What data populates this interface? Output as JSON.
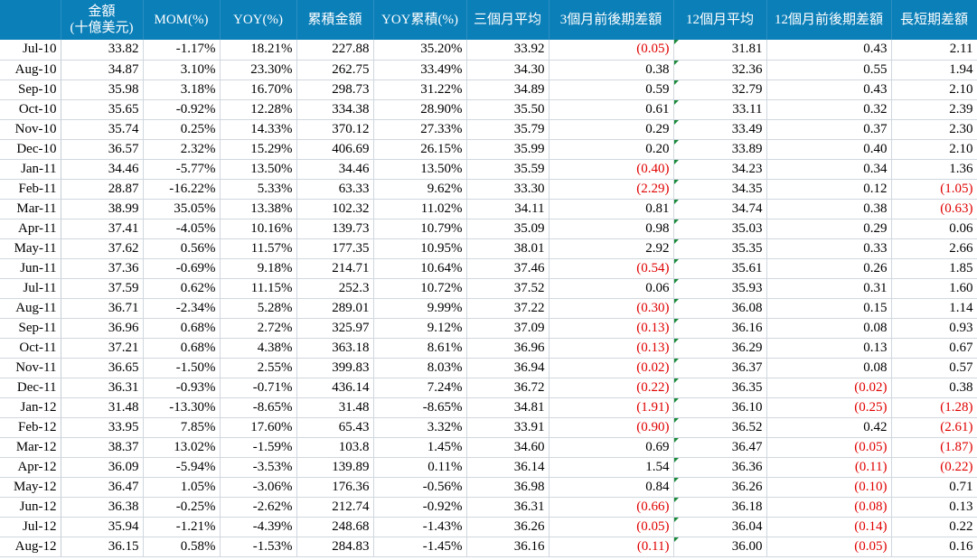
{
  "header": {
    "amount_line1": "金額",
    "amount_line2": "(十億美元)",
    "mom": "MOM(%)",
    "yoy": "YOY(%)",
    "cum_amount": "累積金額",
    "yoy_cum": "YOY累積(%)",
    "avg3": "三個月平均",
    "diff3": "3個月前後期差額",
    "avg12": "12個月平均",
    "diff12": "12個月前後期差額",
    "long_short": "長短期差額"
  },
  "rows": [
    {
      "month": "Jul-10",
      "amount": "33.82",
      "mom": "-1.17%",
      "yoy": "18.21%",
      "cum": "227.88",
      "yoycum": "35.20%",
      "avg3": "33.92",
      "diff3": "(0.05)",
      "avg12": "31.81",
      "diff12": "0.43",
      "ls": "2.11"
    },
    {
      "month": "Aug-10",
      "amount": "34.87",
      "mom": "3.10%",
      "yoy": "23.30%",
      "cum": "262.75",
      "yoycum": "33.49%",
      "avg3": "34.30",
      "diff3": "0.38",
      "avg12": "32.36",
      "diff12": "0.55",
      "ls": "1.94"
    },
    {
      "month": "Sep-10",
      "amount": "35.98",
      "mom": "3.18%",
      "yoy": "16.70%",
      "cum": "298.73",
      "yoycum": "31.22%",
      "avg3": "34.89",
      "diff3": "0.59",
      "avg12": "32.79",
      "diff12": "0.43",
      "ls": "2.10"
    },
    {
      "month": "Oct-10",
      "amount": "35.65",
      "mom": "-0.92%",
      "yoy": "12.28%",
      "cum": "334.38",
      "yoycum": "28.90%",
      "avg3": "35.50",
      "diff3": "0.61",
      "avg12": "33.11",
      "diff12": "0.32",
      "ls": "2.39"
    },
    {
      "month": "Nov-10",
      "amount": "35.74",
      "mom": "0.25%",
      "yoy": "14.33%",
      "cum": "370.12",
      "yoycum": "27.33%",
      "avg3": "35.79",
      "diff3": "0.29",
      "avg12": "33.49",
      "diff12": "0.37",
      "ls": "2.30"
    },
    {
      "month": "Dec-10",
      "amount": "36.57",
      "mom": "2.32%",
      "yoy": "15.29%",
      "cum": "406.69",
      "yoycum": "26.15%",
      "avg3": "35.99",
      "diff3": "0.20",
      "avg12": "33.89",
      "diff12": "0.40",
      "ls": "2.10"
    },
    {
      "month": "Jan-11",
      "amount": "34.46",
      "mom": "-5.77%",
      "yoy": "13.50%",
      "cum": "34.46",
      "yoycum": "13.50%",
      "avg3": "35.59",
      "diff3": "(0.40)",
      "avg12": "34.23",
      "diff12": "0.34",
      "ls": "1.36"
    },
    {
      "month": "Feb-11",
      "amount": "28.87",
      "mom": "-16.22%",
      "yoy": "5.33%",
      "cum": "63.33",
      "yoycum": "9.62%",
      "avg3": "33.30",
      "diff3": "(2.29)",
      "avg12": "34.35",
      "diff12": "0.12",
      "ls": "(1.05)"
    },
    {
      "month": "Mar-11",
      "amount": "38.99",
      "mom": "35.05%",
      "yoy": "13.38%",
      "cum": "102.32",
      "yoycum": "11.02%",
      "avg3": "34.11",
      "diff3": "0.81",
      "avg12": "34.74",
      "diff12": "0.38",
      "ls": "(0.63)"
    },
    {
      "month": "Apr-11",
      "amount": "37.41",
      "mom": "-4.05%",
      "yoy": "10.16%",
      "cum": "139.73",
      "yoycum": "10.79%",
      "avg3": "35.09",
      "diff3": "0.98",
      "avg12": "35.03",
      "diff12": "0.29",
      "ls": "0.06"
    },
    {
      "month": "May-11",
      "amount": "37.62",
      "mom": "0.56%",
      "yoy": "11.57%",
      "cum": "177.35",
      "yoycum": "10.95%",
      "avg3": "38.01",
      "diff3": "2.92",
      "avg12": "35.35",
      "diff12": "0.33",
      "ls": "2.66"
    },
    {
      "month": "Jun-11",
      "amount": "37.36",
      "mom": "-0.69%",
      "yoy": "9.18%",
      "cum": "214.71",
      "yoycum": "10.64%",
      "avg3": "37.46",
      "diff3": "(0.54)",
      "avg12": "35.61",
      "diff12": "0.26",
      "ls": "1.85"
    },
    {
      "month": "Jul-11",
      "amount": "37.59",
      "mom": "0.62%",
      "yoy": "11.15%",
      "cum": "252.3",
      "yoycum": "10.72%",
      "avg3": "37.52",
      "diff3": "0.06",
      "avg12": "35.93",
      "diff12": "0.31",
      "ls": "1.60"
    },
    {
      "month": "Aug-11",
      "amount": "36.71",
      "mom": "-2.34%",
      "yoy": "5.28%",
      "cum": "289.01",
      "yoycum": "9.99%",
      "avg3": "37.22",
      "diff3": "(0.30)",
      "avg12": "36.08",
      "diff12": "0.15",
      "ls": "1.14"
    },
    {
      "month": "Sep-11",
      "amount": "36.96",
      "mom": "0.68%",
      "yoy": "2.72%",
      "cum": "325.97",
      "yoycum": "9.12%",
      "avg3": "37.09",
      "diff3": "(0.13)",
      "avg12": "36.16",
      "diff12": "0.08",
      "ls": "0.93"
    },
    {
      "month": "Oct-11",
      "amount": "37.21",
      "mom": "0.68%",
      "yoy": "4.38%",
      "cum": "363.18",
      "yoycum": "8.61%",
      "avg3": "36.96",
      "diff3": "(0.13)",
      "avg12": "36.29",
      "diff12": "0.13",
      "ls": "0.67"
    },
    {
      "month": "Nov-11",
      "amount": "36.65",
      "mom": "-1.50%",
      "yoy": "2.55%",
      "cum": "399.83",
      "yoycum": "8.03%",
      "avg3": "36.94",
      "diff3": "(0.02)",
      "avg12": "36.37",
      "diff12": "0.08",
      "ls": "0.57"
    },
    {
      "month": "Dec-11",
      "amount": "36.31",
      "mom": "-0.93%",
      "yoy": "-0.71%",
      "cum": "436.14",
      "yoycum": "7.24%",
      "avg3": "36.72",
      "diff3": "(0.22)",
      "avg12": "36.35",
      "diff12": "(0.02)",
      "ls": "0.38"
    },
    {
      "month": "Jan-12",
      "amount": "31.48",
      "mom": "-13.30%",
      "yoy": "-8.65%",
      "cum": "31.48",
      "yoycum": "-8.65%",
      "avg3": "34.81",
      "diff3": "(1.91)",
      "avg12": "36.10",
      "diff12": "(0.25)",
      "ls": "(1.28)"
    },
    {
      "month": "Feb-12",
      "amount": "33.95",
      "mom": "7.85%",
      "yoy": "17.60%",
      "cum": "65.43",
      "yoycum": "3.32%",
      "avg3": "33.91",
      "diff3": "(0.90)",
      "avg12": "36.52",
      "diff12": "0.42",
      "ls": "(2.61)"
    },
    {
      "month": "Mar-12",
      "amount": "38.37",
      "mom": "13.02%",
      "yoy": "-1.59%",
      "cum": "103.8",
      "yoycum": "1.45%",
      "avg3": "34.60",
      "diff3": "0.69",
      "avg12": "36.47",
      "diff12": "(0.05)",
      "ls": "(1.87)"
    },
    {
      "month": "Apr-12",
      "amount": "36.09",
      "mom": "-5.94%",
      "yoy": "-3.53%",
      "cum": "139.89",
      "yoycum": "0.11%",
      "avg3": "36.14",
      "diff3": "1.54",
      "avg12": "36.36",
      "diff12": "(0.11)",
      "ls": "(0.22)"
    },
    {
      "month": "May-12",
      "amount": "36.47",
      "mom": "1.05%",
      "yoy": "-3.06%",
      "cum": "176.36",
      "yoycum": "-0.56%",
      "avg3": "36.98",
      "diff3": "0.84",
      "avg12": "36.26",
      "diff12": "(0.10)",
      "ls": "0.71"
    },
    {
      "month": "Jun-12",
      "amount": "36.38",
      "mom": "-0.25%",
      "yoy": "-2.62%",
      "cum": "212.74",
      "yoycum": "-0.92%",
      "avg3": "36.31",
      "diff3": "(0.66)",
      "avg12": "36.18",
      "diff12": "(0.08)",
      "ls": "0.13"
    },
    {
      "month": "Jul-12",
      "amount": "35.94",
      "mom": "-1.21%",
      "yoy": "-4.39%",
      "cum": "248.68",
      "yoycum": "-1.43%",
      "avg3": "36.26",
      "diff3": "(0.05)",
      "avg12": "36.04",
      "diff12": "(0.14)",
      "ls": "0.22"
    },
    {
      "month": "Aug-12",
      "amount": "36.15",
      "mom": "0.58%",
      "yoy": "-1.53%",
      "cum": "284.83",
      "yoycum": "-1.45%",
      "avg3": "36.16",
      "diff3": "(0.11)",
      "avg12": "36.00",
      "diff12": "(0.05)",
      "ls": "0.16"
    }
  ],
  "colors": {
    "header_bg": "#0b7fb8",
    "header_text": "#ffffff",
    "negative_text": "#e00000",
    "grid_line": "#d0d7df",
    "error_flag": "#1a8a3a"
  }
}
